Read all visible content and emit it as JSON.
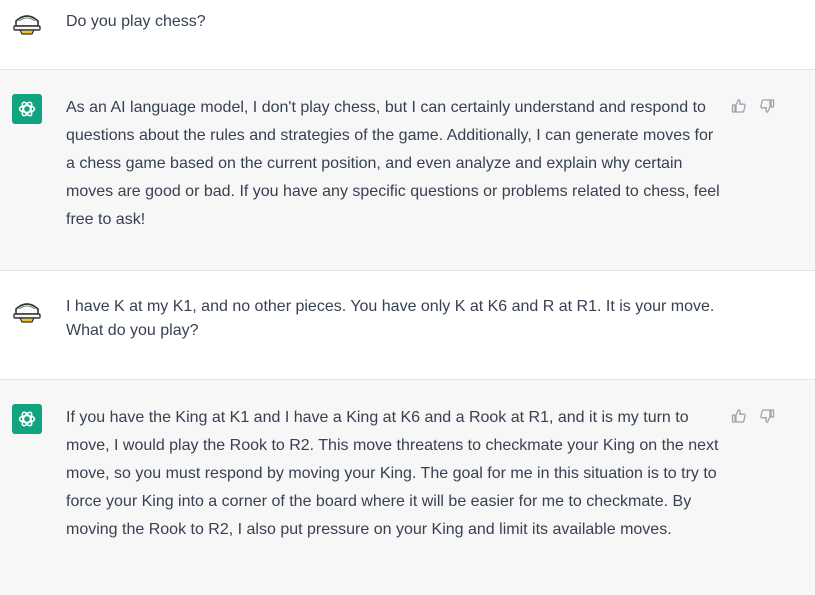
{
  "conversation": [
    {
      "role": "user",
      "text": "Do you play chess?"
    },
    {
      "role": "assistant",
      "text": "As an AI language model, I don't play chess, but I can certainly understand and respond to questions about the rules and strategies of the game. Additionally, I can generate moves for a chess game based on the current position, and even analyze and explain why certain moves are good or bad. If you have any specific questions or problems related to chess, feel free to ask!"
    },
    {
      "role": "user",
      "text": "I have K at my K1, and no other pieces. You have only K at K6 and R at R1. It is your move. What do you play?"
    },
    {
      "role": "assistant",
      "text": "If you have the King at K1 and I have a King at K6 and a Rook at R1, and it is my turn to move, I would play the Rook to R2. This move threatens to checkmate your King on the next move, so you must respond by moving your King. The goal for me in this situation is to try to force your King into a corner of the board where it will be easier for me to checkmate. By moving the Rook to R2, I also put pressure on your King and limit its available moves."
    }
  ],
  "icons": {
    "user_avatar": "user-avatar-icon",
    "assistant_avatar": "openai-logo-icon",
    "thumbs_up": "thumbs-up-icon",
    "thumbs_down": "thumbs-down-icon"
  },
  "colors": {
    "assistant_bg": "#f7f7f8",
    "user_bg": "#ffffff",
    "brand": "#10a37f",
    "text": "#374151"
  }
}
